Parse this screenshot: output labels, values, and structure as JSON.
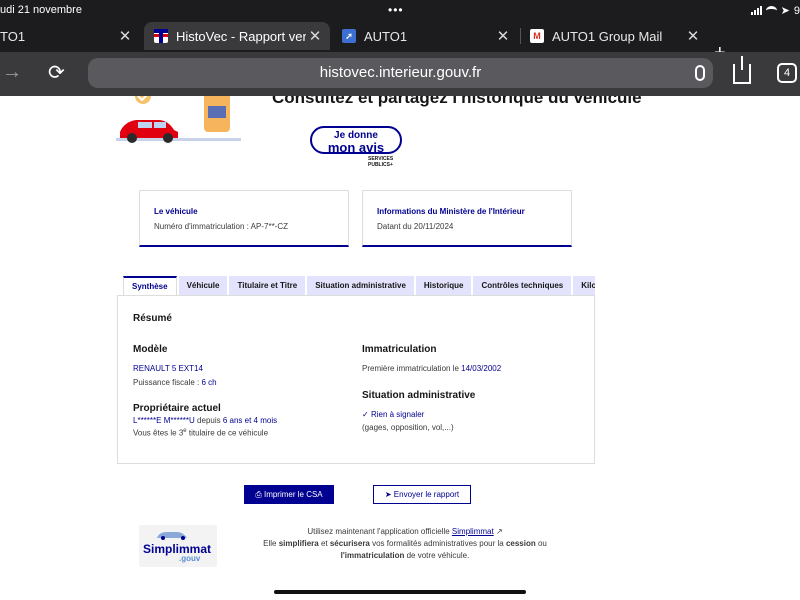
{
  "status_bar": {
    "time": "udi 21 novembre",
    "dots": "•••",
    "battery": "9"
  },
  "browser": {
    "tabs": [
      {
        "label": "TO1",
        "active": false
      },
      {
        "label": "HistoVec - Rapport vendeur",
        "active": true
      },
      {
        "label": "AUTO1",
        "active": false
      },
      {
        "label": "AUTO1 Group Mail",
        "active": false
      }
    ],
    "new_tab": "+",
    "url": "histovec.interieur.gouv.fr",
    "tab_count": "4"
  },
  "header": {
    "headline": "Consultez et partagez l'historique du véhicule",
    "feedback_line1": "Je donne",
    "feedback_line2": "mon avis",
    "services_publics_line1": "SERVICES",
    "services_publics_line2": "PUBLICS+"
  },
  "cards": [
    {
      "title": "Le véhicule",
      "value": "Numéro d'immatriculation : AP-7**-CZ"
    },
    {
      "title": "Informations du Ministère de l'Intérieur",
      "value": "Datant du 20/11/2024"
    }
  ],
  "report_tabs": [
    {
      "label": "Synthèse",
      "active": true
    },
    {
      "label": "Véhicule"
    },
    {
      "label": "Titulaire et Titre"
    },
    {
      "label": "Situation administrative"
    },
    {
      "label": "Historique"
    },
    {
      "label": "Contrôles techniques"
    },
    {
      "label": "Kilo"
    }
  ],
  "summary": {
    "title": "Résumé",
    "model": {
      "title": "Modèle",
      "name": "RENAULT 5 EXT14",
      "power_label": "Puissance fiscale :",
      "power_value": "6 ch"
    },
    "owner": {
      "title": "Propriétaire actuel",
      "name": "L******E M******U",
      "since_label": "depuis",
      "since_value": "6 ans et 4 mois",
      "rank_prefix": "Vous êtes le",
      "rank_num": "3",
      "rank_sup": "e",
      "rank_suffix": "titulaire de ce véhicule"
    },
    "registration": {
      "title": "Immatriculation",
      "first_label": "Première immatriculation le",
      "first_date": "14/03/2002"
    },
    "admin": {
      "title": "Situation administrative",
      "status": "Rien à signaler",
      "details": "(gages, opposition, vol,...)"
    }
  },
  "actions": {
    "print": "Imprimer le CSA",
    "send": "Envoyer le rapport"
  },
  "simplimmat": {
    "logo_main": "Simplimmat",
    "logo_sub": ".gouv",
    "line1_pre": "Utilisez maintenant l'application officielle",
    "line1_link": "Simplimmat",
    "line2_a": "Elle",
    "line2_b": "simplifiera",
    "line2_c": "et",
    "line2_d": "sécurisera",
    "line2_e": "vos formalités administratives pour la",
    "line2_f": "cession",
    "line2_g": "ou",
    "line3_a": "l'immatriculation",
    "line3_b": "de votre véhicule."
  },
  "colors": {
    "primary": "#000091",
    "tab_inactive": "#e3e3fd",
    "chrome_dark": "#1c1c1e",
    "chrome_toolbar": "#3a3a3c"
  }
}
